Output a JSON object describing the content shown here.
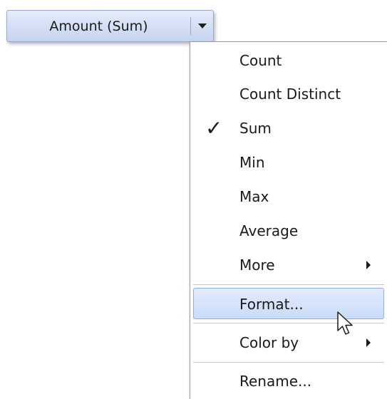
{
  "field_button": {
    "label": "Amount (Sum)",
    "dropdown_icon": "caret-down-icon"
  },
  "menu": {
    "items": [
      {
        "label": "Count",
        "checked": false,
        "submenu": false
      },
      {
        "label": "Count Distinct",
        "checked": false,
        "submenu": false
      },
      {
        "label": "Sum",
        "checked": true,
        "submenu": false
      },
      {
        "label": "Min",
        "checked": false,
        "submenu": false
      },
      {
        "label": "Max",
        "checked": false,
        "submenu": false
      },
      {
        "label": "Average",
        "checked": false,
        "submenu": false
      },
      {
        "label": "More",
        "checked": false,
        "submenu": true
      },
      {
        "label": "Format...",
        "checked": false,
        "submenu": false,
        "hovered": true
      },
      {
        "label": "Color by",
        "checked": false,
        "submenu": true
      },
      {
        "label": "Rename...",
        "checked": false,
        "submenu": false
      }
    ],
    "check_glyph": "✓"
  },
  "colors": {
    "button_fill": "#d3def5",
    "hover_fill": "#c9dbf8",
    "hover_border": "#8faee6"
  }
}
